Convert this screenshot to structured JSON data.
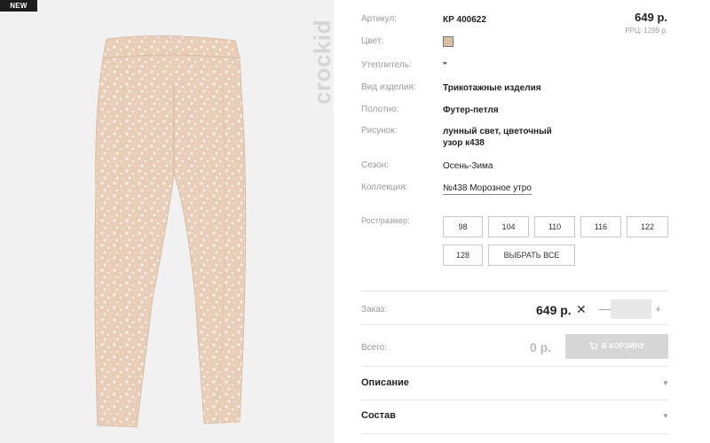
{
  "badge": "NEW",
  "brand": "crockid",
  "product": {
    "sku_label": "Артикул:",
    "sku_value": "КР 400622",
    "price": "649 р.",
    "rrc": "РРЦ: 1299 р.",
    "color_label": "Цвет:",
    "color_swatch": "#d8c1a4",
    "insulation_label": "Утеплитель:",
    "insulation_value": "\"",
    "type_label": "Вид изделия:",
    "type_value": "Трикотажные изделия",
    "fabric_label": "Полотно:",
    "fabric_value": "Футер-петля",
    "pattern_label": "Рисунок:",
    "pattern_line1": "лунный свет, цветочный",
    "pattern_line2": "узор к438",
    "season_label": "Сезон:",
    "season_value": "Осень-Зима",
    "collection_label": "Коллекция:",
    "collection_value": "№438 Морозное утро"
  },
  "sizes": {
    "label": "Рост/размер:",
    "items": [
      "98",
      "104",
      "110",
      "116",
      "122",
      "128"
    ],
    "select_all": "ВЫБРАТЬ ВСЕ"
  },
  "order": {
    "label": "Заказ:",
    "price": "649 р.",
    "remove": "✕",
    "minus": "—",
    "plus": "+",
    "quantity": ""
  },
  "total": {
    "label": "Всего:",
    "value": "0 р.",
    "cart_button": "В КОРЗИНУ"
  },
  "sections": {
    "description": "Описание",
    "composition": "Состав",
    "arrow": "▼"
  },
  "colors": {
    "fabric": "#e8cdb8",
    "dots": "#fbf2e8",
    "cart_disabled": "#d6d6d6"
  }
}
